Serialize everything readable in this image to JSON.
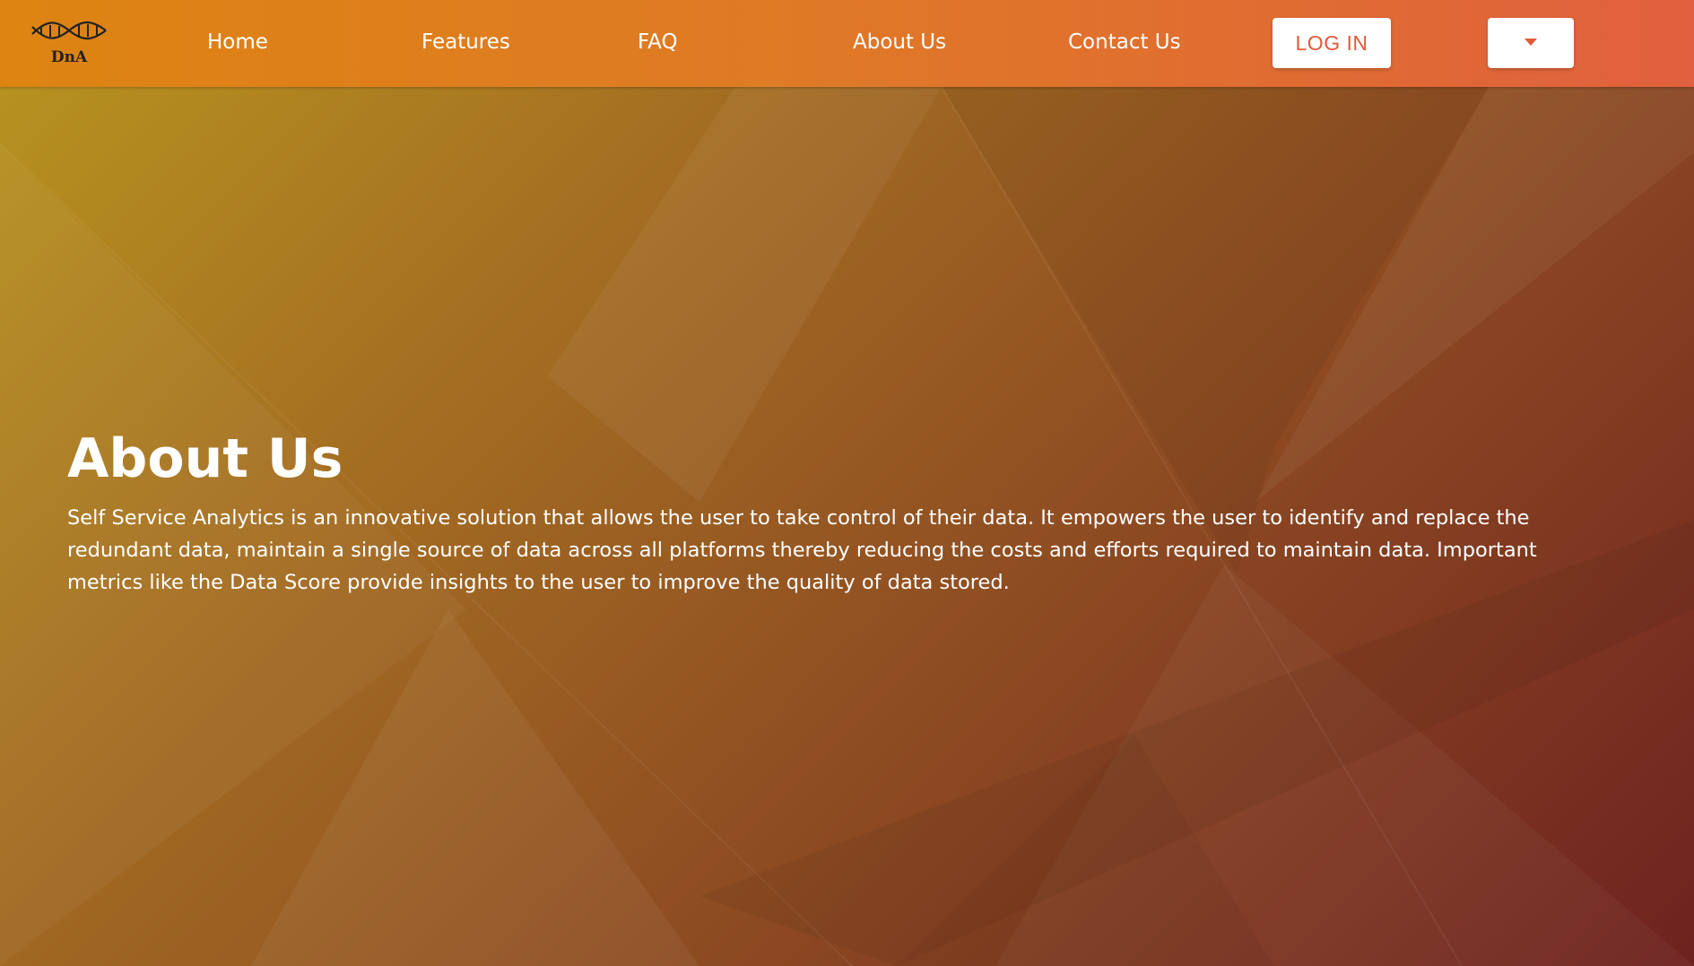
{
  "brand": {
    "logo_text": "DnA",
    "logo_icon": "dna-helix-icon"
  },
  "nav": {
    "links": [
      "Home",
      "Features",
      "FAQ",
      "About Us",
      "Contact Us"
    ],
    "login_label": "LOG IN",
    "dropdown_icon": "caret-down-icon"
  },
  "hero": {
    "title": "About Us",
    "description": "Self Service Analytics is an innovative solution that allows the user to take control of their data. It empowers the user to identify and replace the redundant data, maintain a single source of data across all platforms thereby reducing the costs and efforts required to maintain data. Important metrics like the Data Score provide insights to the user to improve the quality of data stored."
  },
  "colors": {
    "navbar_start": "#dd8412",
    "navbar_end": "#e1603f",
    "accent": "#e05a3a",
    "background_start": "#b8961f",
    "background_end": "#6e2220",
    "text": "#ffffff"
  }
}
